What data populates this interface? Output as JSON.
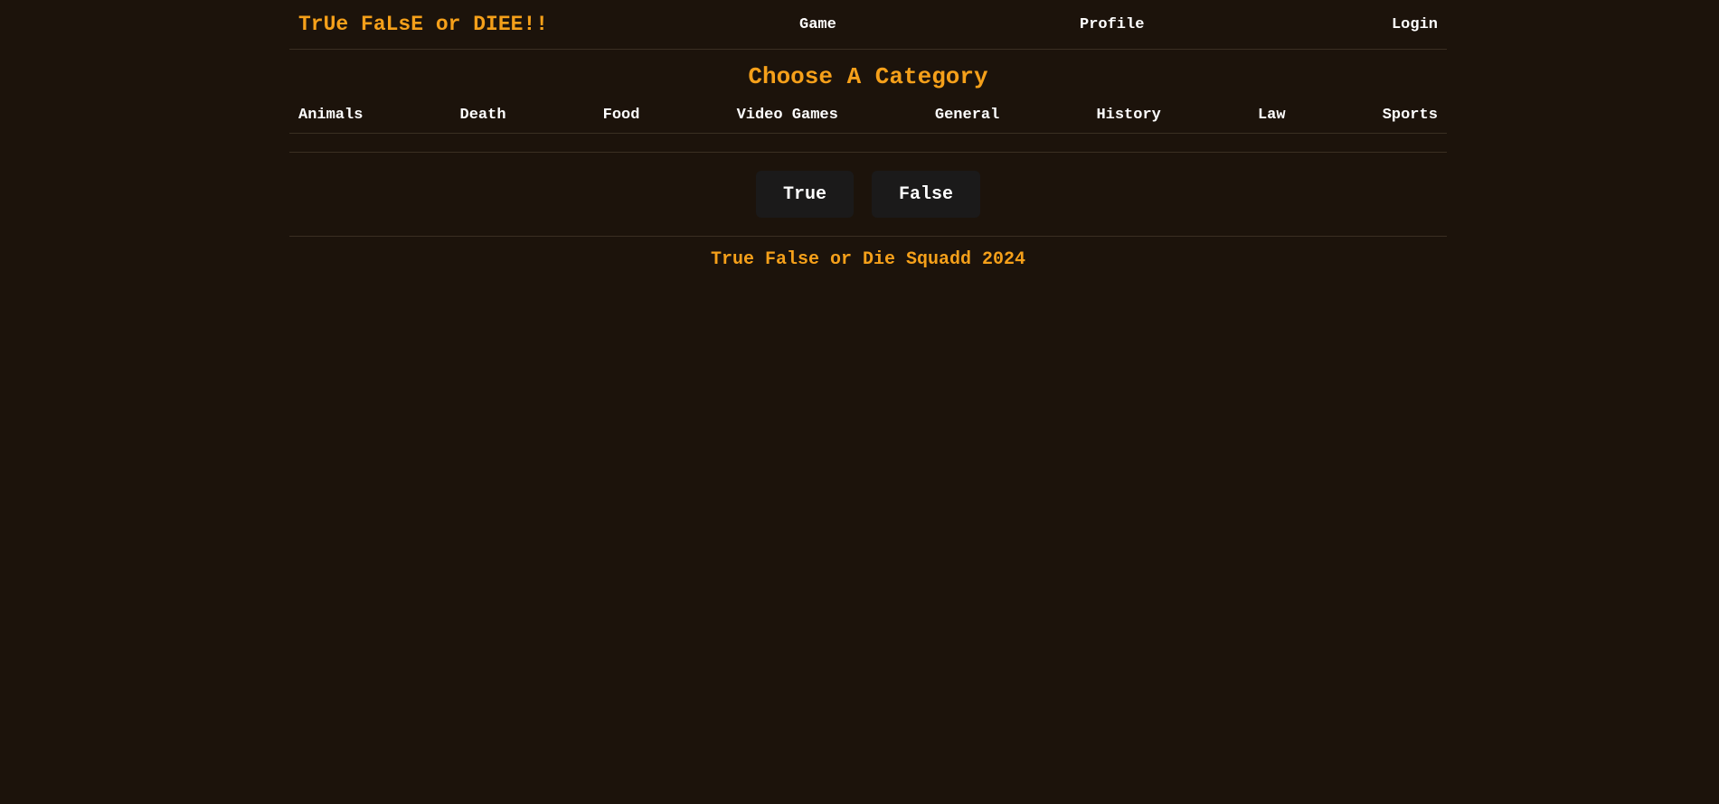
{
  "navbar": {
    "brand": "TrUe FaLsE or DIEE!!",
    "links": {
      "game": "Game",
      "profile": "Profile",
      "login": "Login"
    }
  },
  "categories": {
    "title": "Choose A Category",
    "items": [
      "Animals",
      "Death",
      "Food",
      "Video Games",
      "General",
      "History",
      "Law",
      "Sports"
    ]
  },
  "answers": {
    "true_label": "True",
    "false_label": "False"
  },
  "footer": {
    "text": "True False or Die Squadd 2024"
  },
  "colors": {
    "background": "#1c130b",
    "accent": "#f5a01a",
    "button_bg": "#1b1a1a"
  }
}
